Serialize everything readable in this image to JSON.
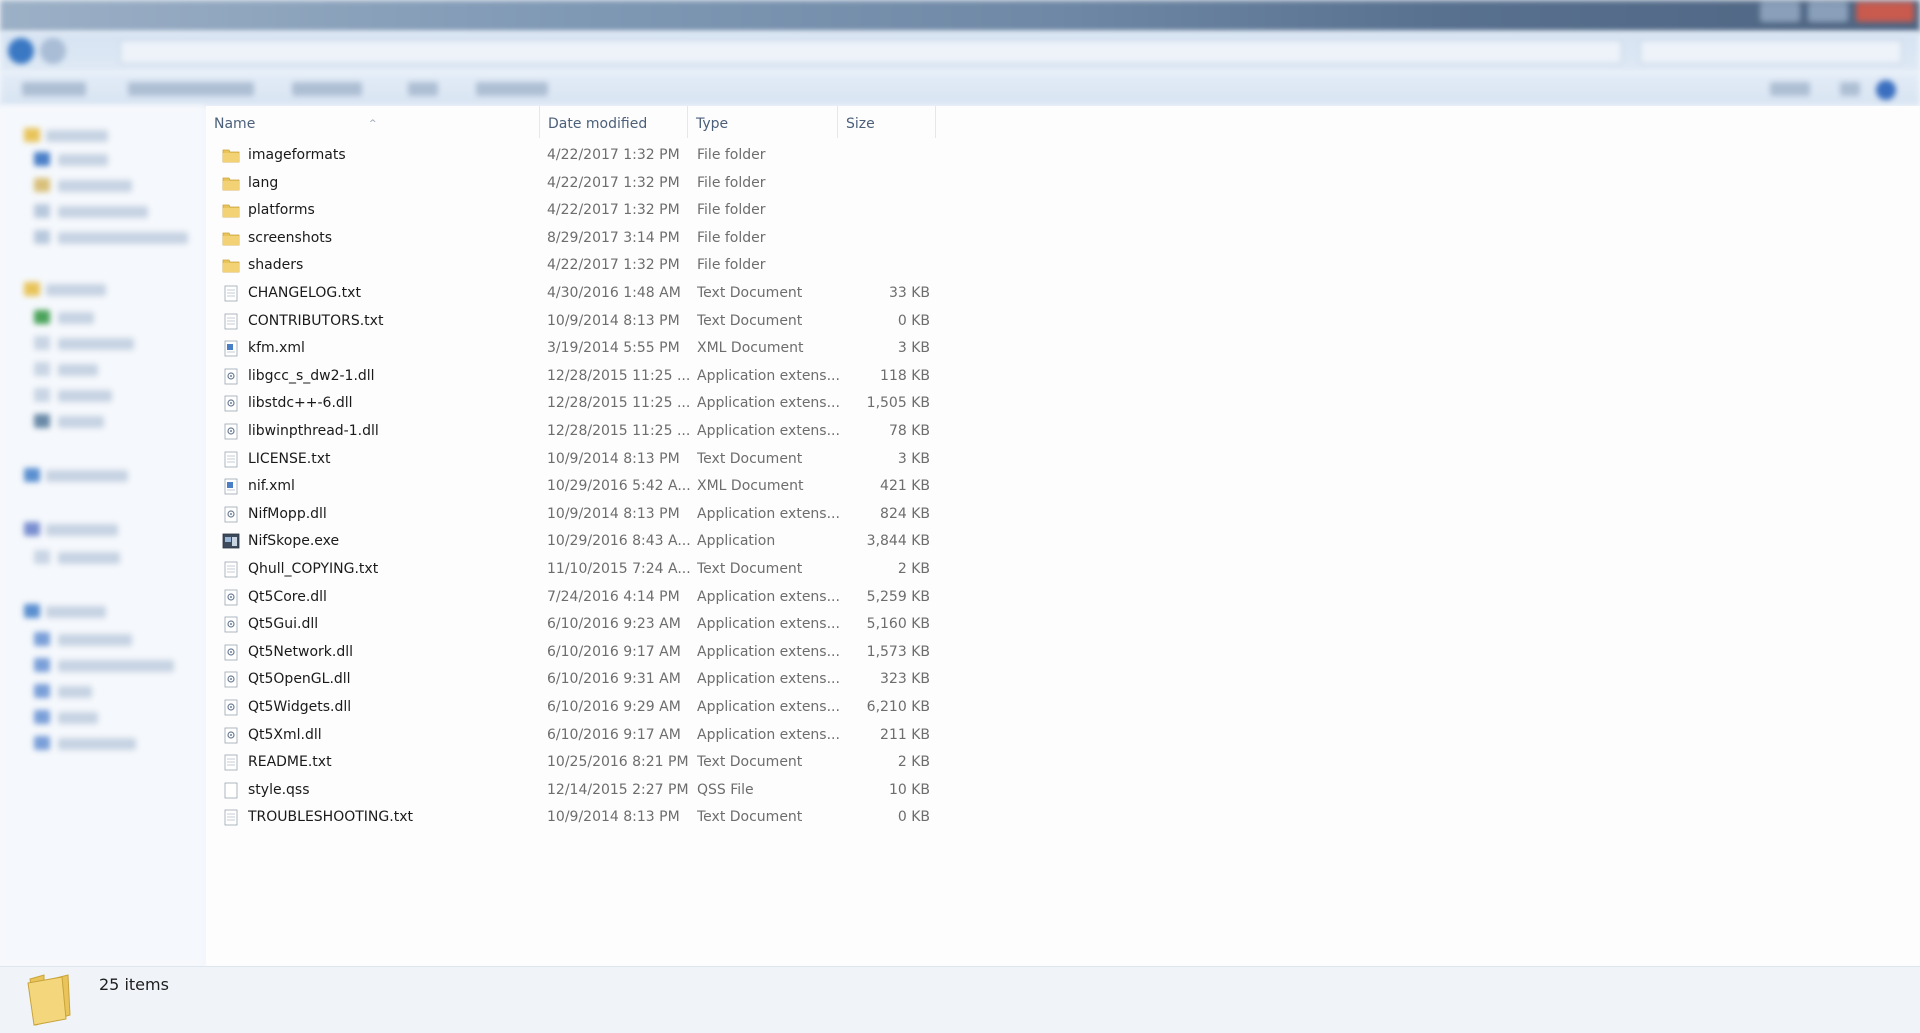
{
  "columns": {
    "name": "Name",
    "date": "Date modified",
    "type": "Type",
    "size": "Size"
  },
  "files": [
    {
      "name": "imageformats",
      "date": "4/22/2017 1:32 PM",
      "type": "File folder",
      "size": "",
      "icon": "folder-icon"
    },
    {
      "name": "lang",
      "date": "4/22/2017 1:32 PM",
      "type": "File folder",
      "size": "",
      "icon": "folder-icon"
    },
    {
      "name": "platforms",
      "date": "4/22/2017 1:32 PM",
      "type": "File folder",
      "size": "",
      "icon": "folder-icon"
    },
    {
      "name": "screenshots",
      "date": "8/29/2017 3:14 PM",
      "type": "File folder",
      "size": "",
      "icon": "folder-icon"
    },
    {
      "name": "shaders",
      "date": "4/22/2017 1:32 PM",
      "type": "File folder",
      "size": "",
      "icon": "folder-icon"
    },
    {
      "name": "CHANGELOG.txt",
      "date": "4/30/2016 1:48 AM",
      "type": "Text Document",
      "size": "33 KB",
      "icon": "text-file-icon"
    },
    {
      "name": "CONTRIBUTORS.txt",
      "date": "10/9/2014 8:13 PM",
      "type": "Text Document",
      "size": "0 KB",
      "icon": "text-file-icon"
    },
    {
      "name": "kfm.xml",
      "date": "3/19/2014 5:55 PM",
      "type": "XML Document",
      "size": "3 KB",
      "icon": "xml-file-icon"
    },
    {
      "name": "libgcc_s_dw2-1.dll",
      "date": "12/28/2015 11:25 ...",
      "type": "Application extens...",
      "size": "118 KB",
      "icon": "dll-file-icon"
    },
    {
      "name": "libstdc++-6.dll",
      "date": "12/28/2015 11:25 ...",
      "type": "Application extens...",
      "size": "1,505 KB",
      "icon": "dll-file-icon"
    },
    {
      "name": "libwinpthread-1.dll",
      "date": "12/28/2015 11:25 ...",
      "type": "Application extens...",
      "size": "78 KB",
      "icon": "dll-file-icon"
    },
    {
      "name": "LICENSE.txt",
      "date": "10/9/2014 8:13 PM",
      "type": "Text Document",
      "size": "3 KB",
      "icon": "text-file-icon"
    },
    {
      "name": "nif.xml",
      "date": "10/29/2016 5:42 A...",
      "type": "XML Document",
      "size": "421 KB",
      "icon": "xml-file-icon"
    },
    {
      "name": "NifMopp.dll",
      "date": "10/9/2014 8:13 PM",
      "type": "Application extens...",
      "size": "824 KB",
      "icon": "dll-file-icon"
    },
    {
      "name": "NifSkope.exe",
      "date": "10/29/2016 8:43 A...",
      "type": "Application",
      "size": "3,844 KB",
      "icon": "app-icon"
    },
    {
      "name": "Qhull_COPYING.txt",
      "date": "11/10/2015 7:24 A...",
      "type": "Text Document",
      "size": "2 KB",
      "icon": "text-file-icon"
    },
    {
      "name": "Qt5Core.dll",
      "date": "7/24/2016 4:14 PM",
      "type": "Application extens...",
      "size": "5,259 KB",
      "icon": "dll-file-icon"
    },
    {
      "name": "Qt5Gui.dll",
      "date": "6/10/2016 9:23 AM",
      "type": "Application extens...",
      "size": "5,160 KB",
      "icon": "dll-file-icon"
    },
    {
      "name": "Qt5Network.dll",
      "date": "6/10/2016 9:17 AM",
      "type": "Application extens...",
      "size": "1,573 KB",
      "icon": "dll-file-icon"
    },
    {
      "name": "Qt5OpenGL.dll",
      "date": "6/10/2016 9:31 AM",
      "type": "Application extens...",
      "size": "323 KB",
      "icon": "dll-file-icon"
    },
    {
      "name": "Qt5Widgets.dll",
      "date": "6/10/2016 9:29 AM",
      "type": "Application extens...",
      "size": "6,210 KB",
      "icon": "dll-file-icon"
    },
    {
      "name": "Qt5Xml.dll",
      "date": "6/10/2016 9:17 AM",
      "type": "Application extens...",
      "size": "211 KB",
      "icon": "dll-file-icon"
    },
    {
      "name": "README.txt",
      "date": "10/25/2016 8:21 PM",
      "type": "Text Document",
      "size": "2 KB",
      "icon": "text-file-icon"
    },
    {
      "name": "style.qss",
      "date": "12/14/2015 2:27 PM",
      "type": "QSS File",
      "size": "10 KB",
      "icon": "generic-file-icon"
    },
    {
      "name": "TROUBLESHOOTING.txt",
      "date": "10/9/2014 8:13 PM",
      "type": "Text Document",
      "size": "0 KB",
      "icon": "text-file-icon"
    }
  ],
  "status": {
    "item_count": "25 items"
  },
  "colors": {
    "folder": "#e8c45a",
    "header_text": "#4c607a",
    "name_text": "#1a1a1a",
    "meta_text": "#6d6d6d"
  }
}
